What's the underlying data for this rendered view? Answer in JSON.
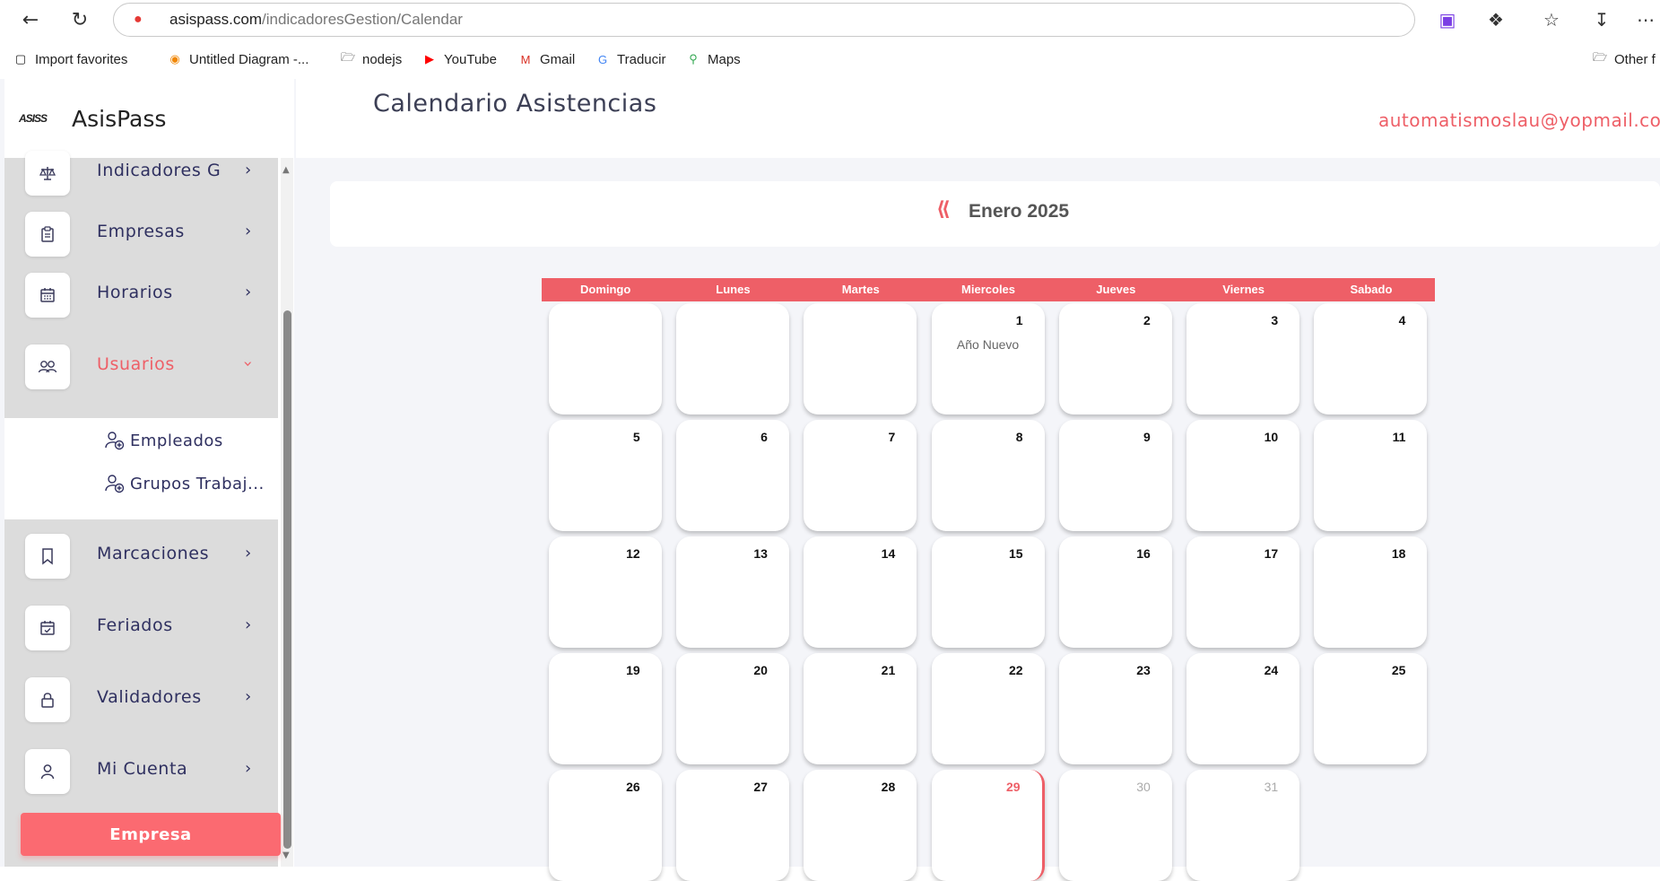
{
  "browser": {
    "url_host": "asispass.com",
    "url_path": "/indicadoresGestion/Calendar",
    "bookmarks": [
      {
        "label": "Import favorites",
        "icon": "import-icon"
      },
      {
        "label": "Untitled Diagram -...",
        "icon": "drawio-icon"
      },
      {
        "label": "nodejs",
        "icon": "folder-icon"
      },
      {
        "label": "YouTube",
        "icon": "youtube-icon"
      },
      {
        "label": "Gmail",
        "icon": "gmail-icon"
      },
      {
        "label": "Traducir",
        "icon": "translate-icon"
      },
      {
        "label": "Maps",
        "icon": "maps-icon"
      },
      {
        "label": "Other f",
        "icon": "folder-icon"
      }
    ]
  },
  "brand": {
    "logo": "ASISS",
    "name": "AsisPass"
  },
  "sidebar": {
    "items": [
      {
        "label": "Indicadores G",
        "icon": "scale-icon"
      },
      {
        "label": "Empresas",
        "icon": "clipboard-icon"
      },
      {
        "label": "Horarios",
        "icon": "calendar-icon"
      },
      {
        "label": "Usuarios",
        "icon": "users-icon",
        "active": true
      },
      {
        "label": "Marcaciones",
        "icon": "bookmark-icon"
      },
      {
        "label": "Feriados",
        "icon": "calendar-check-icon"
      },
      {
        "label": "Validadores",
        "icon": "lock-icon"
      },
      {
        "label": "Mi Cuenta",
        "icon": "user-icon"
      }
    ],
    "subitems": [
      {
        "label": "Empleados",
        "icon": "user-add-icon"
      },
      {
        "label": "Grupos Trabaj...",
        "icon": "user-add-icon"
      }
    ],
    "bottom_button": "Empresa"
  },
  "header": {
    "title": "Calendario Asistencias",
    "user_email": "automatismoslau@yopmail.com"
  },
  "calendar": {
    "month_label": "Enero 2025",
    "weekdays": [
      "Domingo",
      "Lunes",
      "Martes",
      "Miercoles",
      "Jueves",
      "Viernes",
      "Sabado"
    ],
    "days": [
      {
        "n": "",
        "ev": ""
      },
      {
        "n": "",
        "ev": ""
      },
      {
        "n": "",
        "ev": ""
      },
      {
        "n": "1",
        "ev": "Año Nuevo"
      },
      {
        "n": "2",
        "ev": ""
      },
      {
        "n": "3",
        "ev": ""
      },
      {
        "n": "4",
        "ev": ""
      },
      {
        "n": "5",
        "ev": ""
      },
      {
        "n": "6",
        "ev": ""
      },
      {
        "n": "7",
        "ev": ""
      },
      {
        "n": "8",
        "ev": ""
      },
      {
        "n": "9",
        "ev": ""
      },
      {
        "n": "10",
        "ev": ""
      },
      {
        "n": "11",
        "ev": ""
      },
      {
        "n": "12",
        "ev": ""
      },
      {
        "n": "13",
        "ev": ""
      },
      {
        "n": "14",
        "ev": ""
      },
      {
        "n": "15",
        "ev": ""
      },
      {
        "n": "16",
        "ev": ""
      },
      {
        "n": "17",
        "ev": ""
      },
      {
        "n": "18",
        "ev": ""
      },
      {
        "n": "19",
        "ev": ""
      },
      {
        "n": "20",
        "ev": ""
      },
      {
        "n": "21",
        "ev": ""
      },
      {
        "n": "22",
        "ev": ""
      },
      {
        "n": "23",
        "ev": ""
      },
      {
        "n": "24",
        "ev": ""
      },
      {
        "n": "25",
        "ev": ""
      },
      {
        "n": "26",
        "ev": ""
      },
      {
        "n": "27",
        "ev": ""
      },
      {
        "n": "28",
        "ev": ""
      },
      {
        "n": "29",
        "ev": "",
        "today": true
      },
      {
        "n": "30",
        "ev": "",
        "faded": true
      },
      {
        "n": "31",
        "ev": "",
        "faded": true
      }
    ]
  },
  "colors": {
    "accent": "#ee5f67",
    "button": "#fb6a71",
    "sidebar_bg": "#dcdcdc"
  }
}
